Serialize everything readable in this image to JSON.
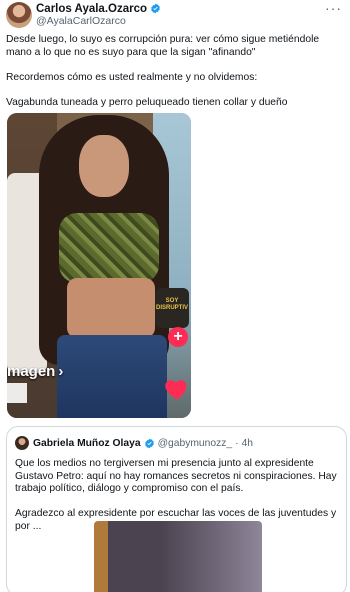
{
  "author": {
    "name": "Carlos Ayala.Ozarco",
    "handle": "@AyalaCarlOzarco",
    "verified": true
  },
  "tweet": {
    "line1": "Desde luego, lo suyo es corrupción pura: ver cómo sigue metiéndole mano a lo que no es suyo para que la sigan \"afinando\"",
    "line2": "Recordemos cómo es usted realmente y no olvidemos:",
    "line3": "Vagabunda tuneada y perro peluqueado tienen collar y dueño"
  },
  "media": {
    "overlay_text": "magen",
    "badge_text": "SOY DISRUPTIV",
    "plus_label": "+",
    "icons": [
      "plus-icon",
      "heart-icon"
    ]
  },
  "quoted": {
    "name": "Gabriela Muñoz Olaya",
    "verified": true,
    "handle": "@gabymunozz_",
    "separator": "·",
    "time": "4h",
    "paragraph1": "Que los medios no tergiversen mi presencia junto al expresidente Gustavo Petro: aquí no hay romances secretos ni conspiraciones. Hay trabajo político, diálogo y compromiso con el país.",
    "paragraph2": "Agradezco al expresidente por escuchar las voces de las juventudes y por ..."
  },
  "colors": {
    "verified_blue": "#1d9bf0",
    "muted_text": "#536471",
    "border": "#cfd9de",
    "tiktok_red": "#fe2c55"
  }
}
